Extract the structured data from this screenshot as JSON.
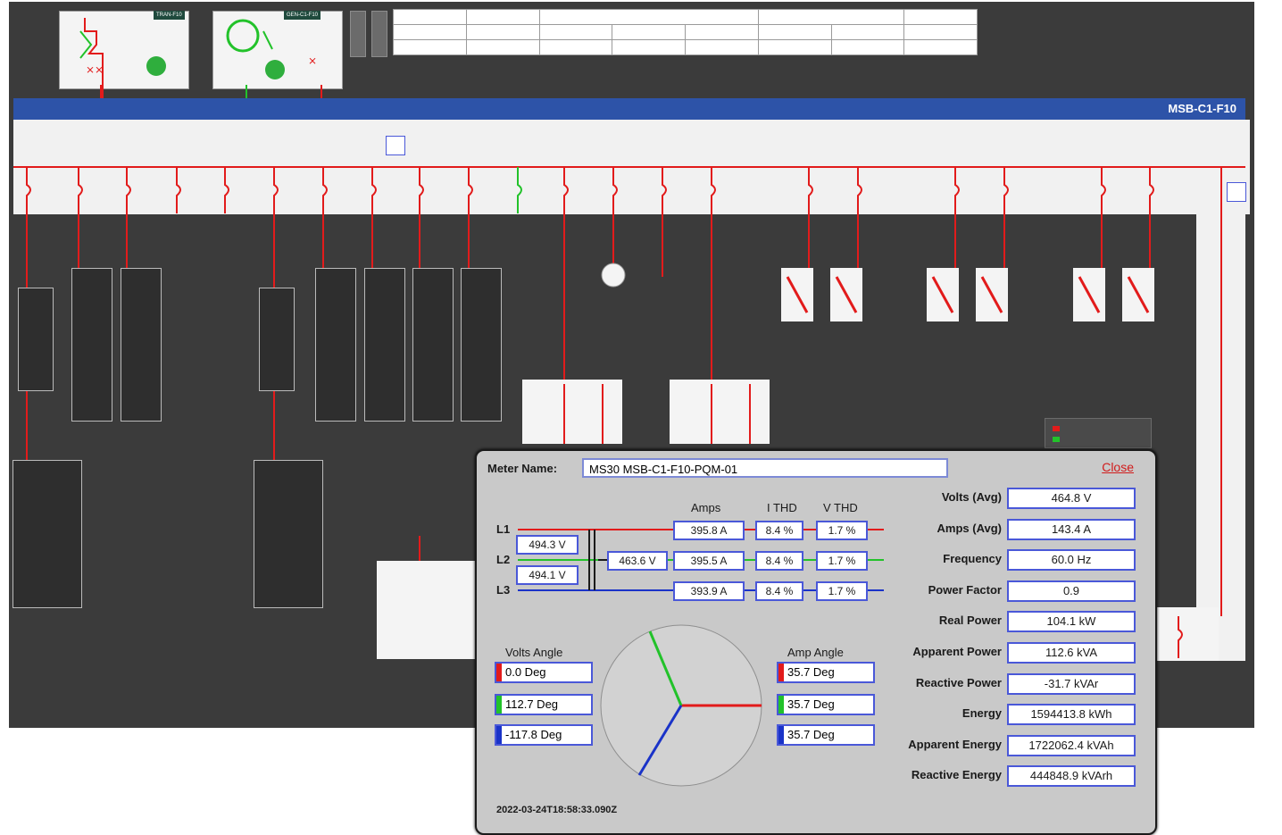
{
  "header": {
    "panel_title": "MSB-C1-F10",
    "tag_left": "TRAN-F10",
    "tag_right": "GEN-C1-F10"
  },
  "meter": {
    "name_label": "Meter Name:",
    "name_value": "MS30 MSB-C1-F10-PQM-01",
    "close_label": "Close",
    "lines": [
      "L1",
      "L2",
      "L3"
    ],
    "col_headers": {
      "amps": "Amps",
      "i_thd": "I THD",
      "v_thd": "V THD"
    },
    "ll_voltages": [
      "494.3 V",
      "494.1 V"
    ],
    "ln_voltage": "463.6 V",
    "amps": [
      "395.8 A",
      "395.5 A",
      "393.9 A"
    ],
    "i_thd": [
      "8.4 %",
      "8.4 %",
      "8.4 %"
    ],
    "v_thd": [
      "1.7 %",
      "1.7 %",
      "1.7 %"
    ],
    "volts_angle_label": "Volts Angle",
    "volts_angles": [
      "0.0 Deg",
      "112.7 Deg",
      "-117.8 Deg"
    ],
    "amp_angle_label": "Amp Angle",
    "amp_angles": [
      "35.7 Deg",
      "35.7 Deg",
      "35.7 Deg"
    ],
    "timestamp": "2022-03-24T18:58:33.090Z",
    "readings": [
      {
        "label": "Volts (Avg)",
        "value": "464.8 V"
      },
      {
        "label": "Amps (Avg)",
        "value": "143.4 A"
      },
      {
        "label": "Frequency",
        "value": "60.0 Hz"
      },
      {
        "label": "Power Factor",
        "value": "0.9"
      },
      {
        "label": "Real Power",
        "value": "104.1 kW"
      },
      {
        "label": "Apparent Power",
        "value": "112.6 kVA"
      },
      {
        "label": "Reactive Power",
        "value": "-31.7 kVAr"
      },
      {
        "label": "Energy",
        "value": "1594413.8 kWh"
      },
      {
        "label": "Apparent Energy",
        "value": "1722062.4 kVAh"
      },
      {
        "label": "Reactive Energy",
        "value": "444848.9 kVArh"
      }
    ]
  },
  "colors": {
    "l1": "#e21b1b",
    "l2": "#22c22a",
    "l3": "#1a33c8",
    "accent": "#4a58d8",
    "banner": "#2d53a8"
  }
}
